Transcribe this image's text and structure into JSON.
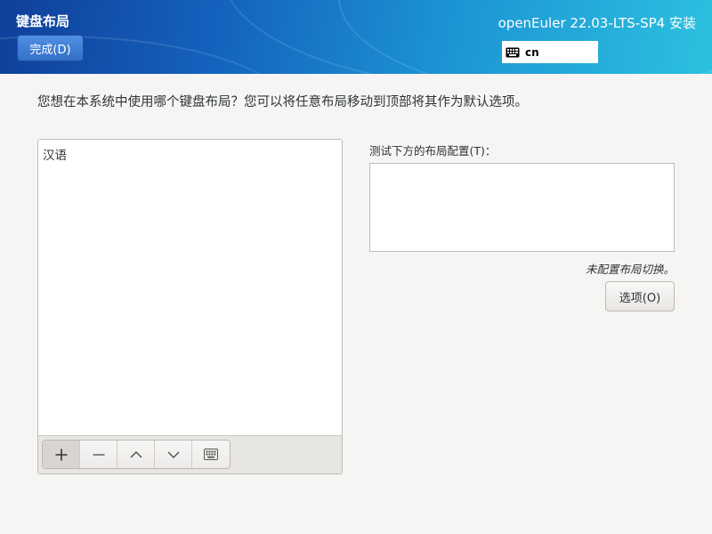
{
  "header": {
    "title": "键盘布局",
    "done_label": "完成(D)",
    "product": "openEuler 22.03-LTS-SP4 安装",
    "layout_indicator": {
      "icon": "keyboard-icon",
      "code": "cn"
    },
    "colors": {
      "gradient_start": "#0f3f9a",
      "gradient_end": "#2cc1df",
      "done_button": "#3a77cf"
    }
  },
  "main": {
    "description": "您想在本系统中使用哪个键盘布局？您可以将任意布局移动到顶部将其作为默认选项。",
    "layouts": [
      "汉语"
    ],
    "toolbar": {
      "add": "plus-icon",
      "remove": "minus-icon",
      "move_up": "chevron-up-icon",
      "move_down": "chevron-down-icon",
      "preview": "keyboard-icon"
    },
    "test_label": "测试下方的布局配置(T)：",
    "test_value": "",
    "switch_note": "未配置布局切换。",
    "options_label": "选项(O)"
  }
}
